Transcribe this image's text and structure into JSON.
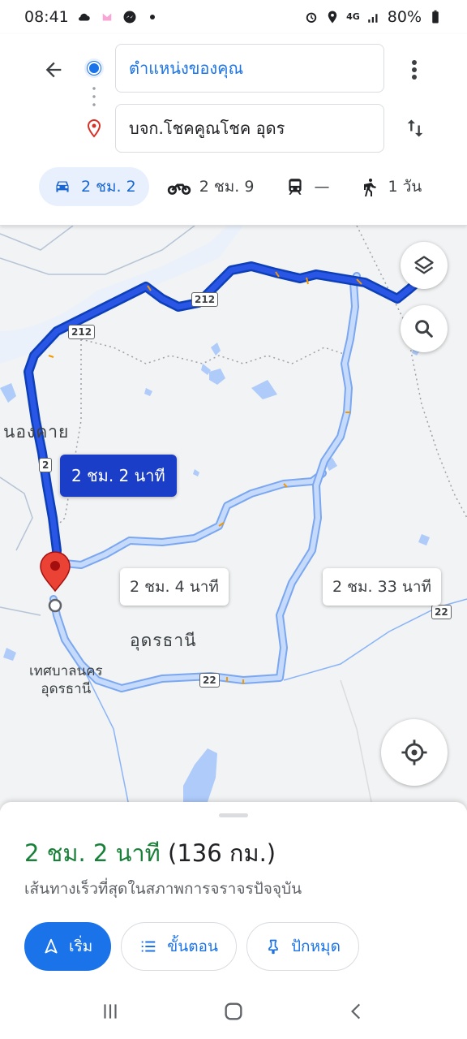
{
  "status_bar": {
    "time": "08:41",
    "battery": "80%",
    "network": "4G"
  },
  "search": {
    "origin": "ตำแหน่งของคุณ",
    "destination": "บจก.โชคคูณโชค อุดร"
  },
  "modes": [
    {
      "icon": "car-icon",
      "label": "2 ชม. 2"
    },
    {
      "icon": "motorcycle-icon",
      "label": "2 ชม. 9"
    },
    {
      "icon": "transit-icon",
      "label": "—"
    },
    {
      "icon": "walk-icon",
      "label": "1 วัน"
    }
  ],
  "map": {
    "labels": {
      "nongkhai": "นองคาย",
      "udonthani": "อุดรธานี",
      "municipality_line1": "เทศบาลนคร",
      "municipality_line2": "อุดรธานี"
    },
    "routes": {
      "primary": "2 ชม. 2 นาที",
      "alt1": "2 ชม. 4 นาที",
      "alt2": "2 ชม. 33 นาที"
    },
    "shields": {
      "s212a": "212",
      "s212b": "212",
      "s2": "2",
      "s22a": "22",
      "s22b": "22"
    }
  },
  "sheet": {
    "duration": "2 ชม. 2 นาที",
    "distance": "(136 กม.)",
    "subtitle": "เส้นทางเร็วที่สุดในสภาพการจราจรปัจจุบัน",
    "buttons": {
      "start": "เริ่ม",
      "steps": "ขั้นตอน",
      "pin": "ปักหมุด"
    }
  },
  "colors": {
    "accent": "#1a73e8",
    "primary_route": "#1a3ec8",
    "alt_route": "#a8c7fa",
    "duration_green": "#188038"
  }
}
